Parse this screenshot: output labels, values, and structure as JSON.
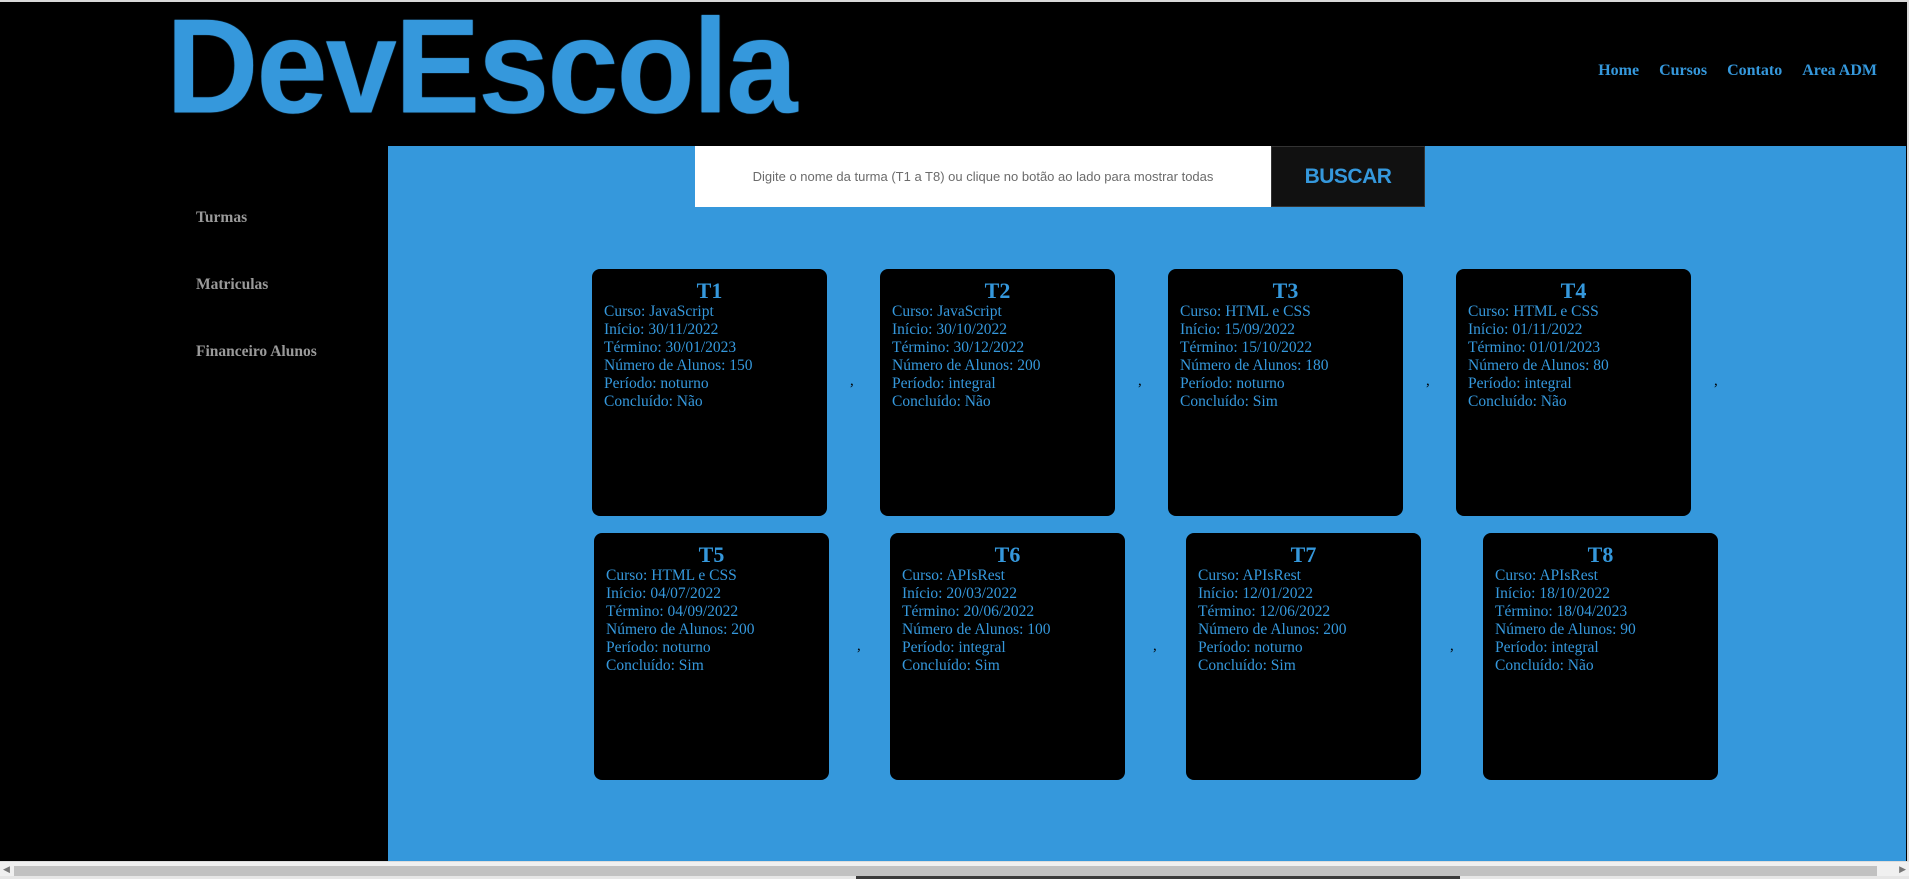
{
  "brand": {
    "logo_text": "DevEscola",
    "accent": "#3598dc"
  },
  "nav": {
    "items": [
      {
        "label": "Home"
      },
      {
        "label": "Cursos"
      },
      {
        "label": "Contato"
      },
      {
        "label": "Area ADM"
      }
    ]
  },
  "sidebar": {
    "items": [
      {
        "label": "Turmas"
      },
      {
        "label": "Matriculas"
      },
      {
        "label": "Financeiro Alunos"
      }
    ]
  },
  "search": {
    "placeholder": "Digite o nome da turma (T1 a T8) ou clique no botão ao lado para mostrar todas",
    "button_label": "BUSCAR"
  },
  "separator": ",",
  "turmas": [
    {
      "title": "T1",
      "curso": "Curso: JavaScript",
      "inicio": "Início: 30/11/2022",
      "termino": "Término: 30/01/2023",
      "alunos": "Número de Alunos: 150",
      "periodo": "Período: noturno",
      "concluido": "Concluído: Não"
    },
    {
      "title": "T2",
      "curso": "Curso: JavaScript",
      "inicio": "Início: 30/10/2022",
      "termino": "Término: 30/12/2022",
      "alunos": "Número de Alunos: 200",
      "periodo": "Período: integral",
      "concluido": "Concluído: Não"
    },
    {
      "title": "T3",
      "curso": "Curso: HTML e CSS",
      "inicio": "Início: 15/09/2022",
      "termino": "Término: 15/10/2022",
      "alunos": "Número de Alunos: 180",
      "periodo": "Período: noturno",
      "concluido": "Concluído: Sim"
    },
    {
      "title": "T4",
      "curso": "Curso: HTML e CSS",
      "inicio": "Início: 01/11/2022",
      "termino": "Término: 01/01/2023",
      "alunos": "Número de Alunos: 80",
      "periodo": "Período: integral",
      "concluido": "Concluído: Não"
    },
    {
      "title": "T5",
      "curso": "Curso: HTML e CSS",
      "inicio": "Início: 04/07/2022",
      "termino": "Término: 04/09/2022",
      "alunos": "Número de Alunos: 200",
      "periodo": "Período: noturno",
      "concluido": "Concluído: Sim"
    },
    {
      "title": "T6",
      "curso": "Curso: APIsRest",
      "inicio": "Início: 20/03/2022",
      "termino": "Término: 20/06/2022",
      "alunos": "Número de Alunos: 100",
      "periodo": "Período: integral",
      "concluido": "Concluído: Sim"
    },
    {
      "title": "T7",
      "curso": "Curso: APIsRest",
      "inicio": "Início: 12/01/2022",
      "termino": "Término: 12/06/2022",
      "alunos": "Número de Alunos: 200",
      "periodo": "Período: noturno",
      "concluido": "Concluído: Sim"
    },
    {
      "title": "T8",
      "curso": "Curso: APIsRest",
      "inicio": "Início: 18/10/2022",
      "termino": "Término: 18/04/2023",
      "alunos": "Número de Alunos: 90",
      "periodo": "Período: integral",
      "concluido": "Concluído: Não"
    }
  ],
  "icons": {
    "scroll_left": "scroll-left-arrow-icon",
    "scroll_right": "scroll-right-arrow-icon"
  }
}
